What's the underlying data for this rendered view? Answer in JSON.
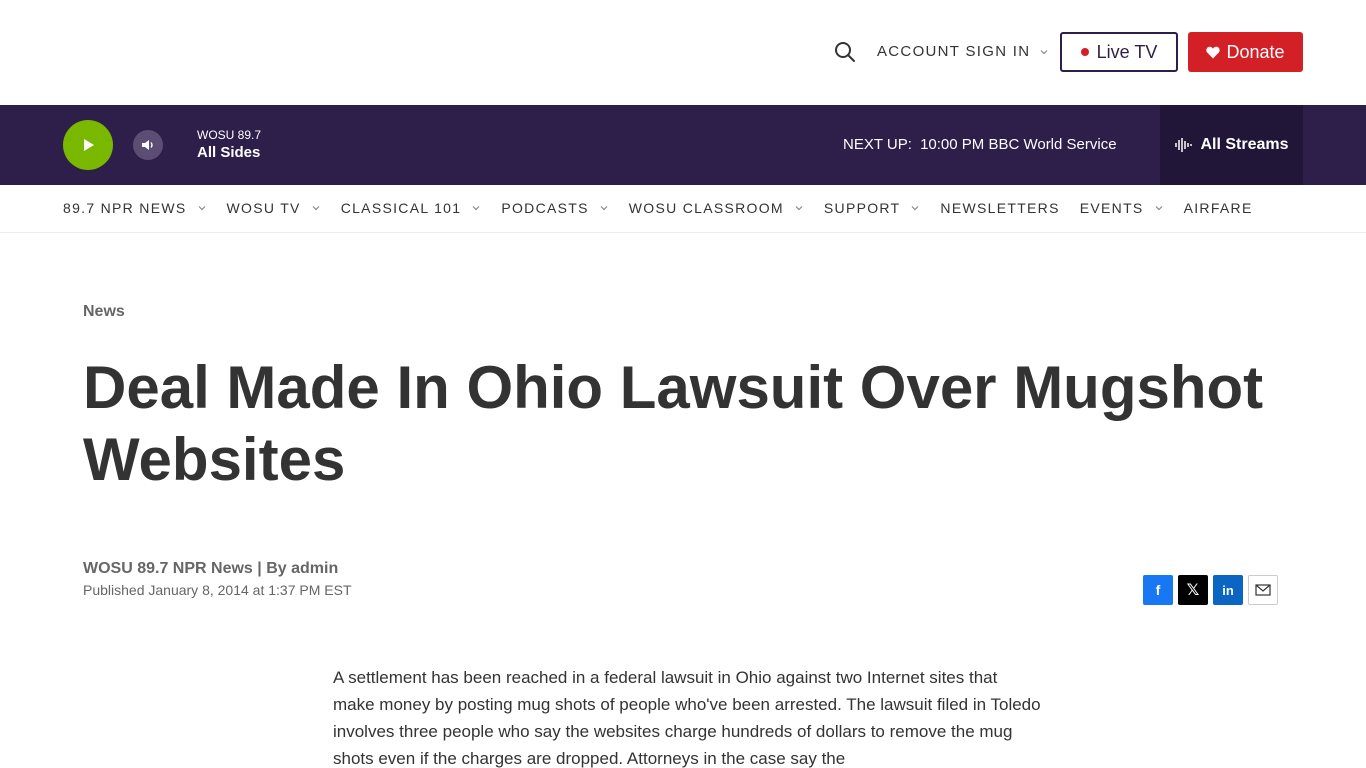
{
  "header": {
    "account_label": "ACCOUNT SIGN IN",
    "live_tv_label": "Live TV",
    "donate_label": "Donate"
  },
  "player": {
    "station": "WOSU 89.7",
    "program": "All Sides",
    "next_up_label": "NEXT UP:",
    "next_up_program": "10:00 PM BBC World Service",
    "all_streams_label": "All Streams"
  },
  "nav": {
    "items": [
      {
        "label": "89.7 NPR NEWS",
        "has_dropdown": true
      },
      {
        "label": "WOSU TV",
        "has_dropdown": true
      },
      {
        "label": "CLASSICAL 101",
        "has_dropdown": true
      },
      {
        "label": "PODCASTS",
        "has_dropdown": true
      },
      {
        "label": "WOSU CLASSROOM",
        "has_dropdown": true
      },
      {
        "label": "SUPPORT",
        "has_dropdown": true
      },
      {
        "label": "NEWSLETTERS",
        "has_dropdown": false
      },
      {
        "label": "EVENTS",
        "has_dropdown": true
      },
      {
        "label": "AIRFARE",
        "has_dropdown": false
      }
    ]
  },
  "article": {
    "section": "News",
    "headline": "Deal Made In Ohio Lawsuit Over Mugshot Websites",
    "byline": "WOSU 89.7 NPR News | By admin",
    "published": "Published January 8, 2014 at 1:37 PM EST",
    "body": "A settlement has been reached in a federal lawsuit in Ohio against two Internet sites that make money by posting mug shots of people who've been arrested. The lawsuit filed in Toledo involves three people who say the websites charge hundreds of dollars to remove the mug shots even if the charges are dropped. Attorneys in the case say the"
  },
  "share": {
    "facebook_glyph": "f",
    "x_glyph": "𝕏",
    "linkedin_glyph": "in"
  },
  "colors": {
    "brand_purple": "#2d1e4a",
    "streams_bg": "#221638",
    "play_green": "#7ab800",
    "donate_red": "#d32027",
    "facebook_blue": "#1877f2",
    "linkedin_blue": "#0a66c2"
  },
  "icons": {
    "search": "search-icon",
    "play": "play-icon",
    "volume": "volume-icon",
    "streams": "audio-wave-icon",
    "heart": "heart-icon",
    "mail": "mail-icon"
  }
}
